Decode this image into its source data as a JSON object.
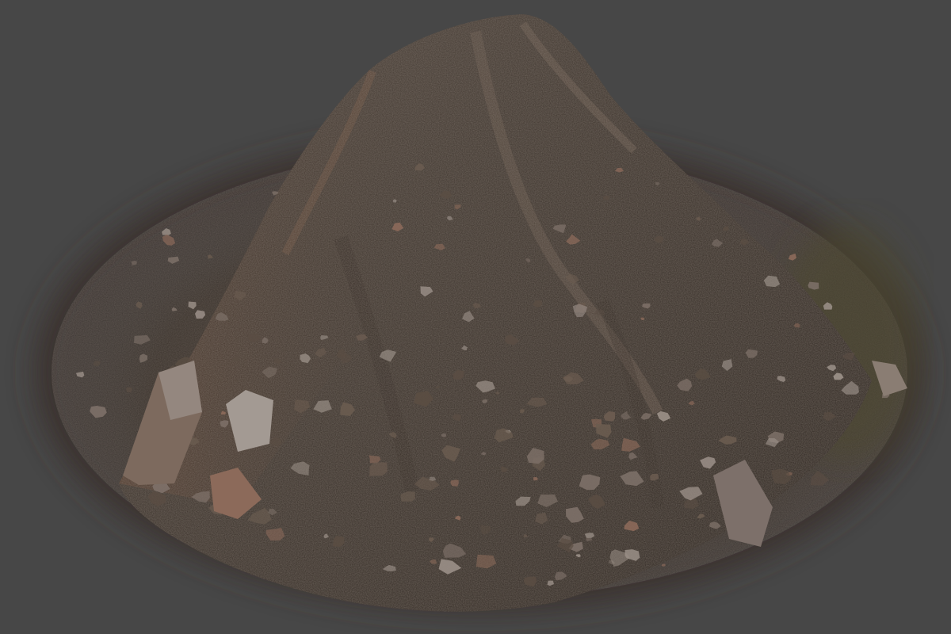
{
  "scene": {
    "subject": "dirt-mound-scan",
    "colors": {
      "background": "#474747",
      "ground_dark": "#2f2a27",
      "ground_mid": "#4a4039",
      "soil_dark": "#2b241f",
      "soil_mid": "#3d342d",
      "soil_light": "#5a4d43",
      "soil_highlight": "#6b5c50",
      "rock_light": "#9a8f87",
      "rock_mid": "#7d7068",
      "rock_warm": "#8c6a5a",
      "grass": "#5b5a32"
    }
  }
}
